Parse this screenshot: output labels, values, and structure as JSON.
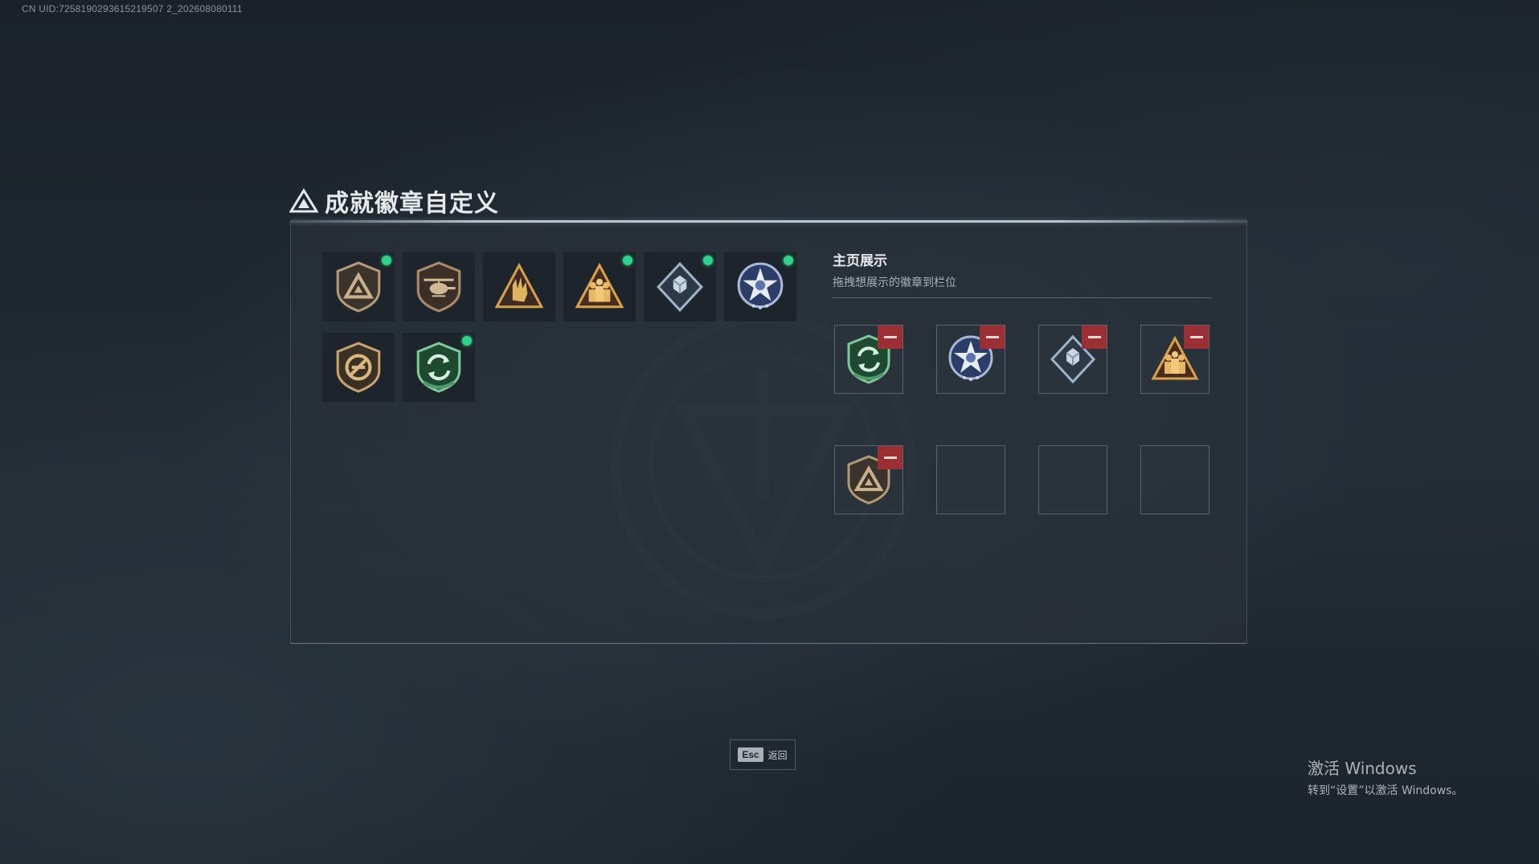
{
  "uid_text": "CN UID:7258190293615219507 2_202608080111",
  "page": {
    "title": "成就徽章自定义"
  },
  "owned_badges": [
    {
      "icon": "tan-triangle-shield-badge-icon",
      "new": true
    },
    {
      "icon": "helicopter-shield-badge-icon",
      "new": false
    },
    {
      "icon": "gold-hand-sign-badge-icon",
      "new": false
    },
    {
      "icon": "gold-soldiers-triangle-badge-icon",
      "new": true
    },
    {
      "icon": "silver-crystal-diamond-badge-icon",
      "new": true
    },
    {
      "icon": "blue-star-medal-badge-icon",
      "new": true
    },
    {
      "icon": "tan-no-gun-shield-badge-icon",
      "new": false
    },
    {
      "icon": "green-cycle-shield-badge-icon",
      "new": true
    }
  ],
  "display": {
    "title": "主页展示",
    "subtitle": "拖拽想展示的徽章到栏位",
    "slots": [
      {
        "icon": "green-cycle-shield-badge-icon",
        "filled": true
      },
      {
        "icon": "blue-star-medal-badge-icon",
        "filled": true
      },
      {
        "icon": "silver-crystal-diamond-badge-icon",
        "filled": true
      },
      {
        "icon": "gold-soldiers-triangle-badge-icon",
        "filled": true
      },
      {
        "icon": "tan-triangle-shield-badge-icon",
        "filled": true
      },
      {
        "icon": "",
        "filled": false
      },
      {
        "icon": "",
        "filled": false
      },
      {
        "icon": "",
        "filled": false
      }
    ]
  },
  "footer": {
    "esc_key": "Esc",
    "esc_label": "返回"
  },
  "watermark": {
    "title": "激活 Windows",
    "subtitle": "转到“设置”以激活 Windows。"
  },
  "colors": {
    "new_dot": "#2fd28b",
    "remove_button": "#9c2f33",
    "panel_bg": "#283039"
  }
}
